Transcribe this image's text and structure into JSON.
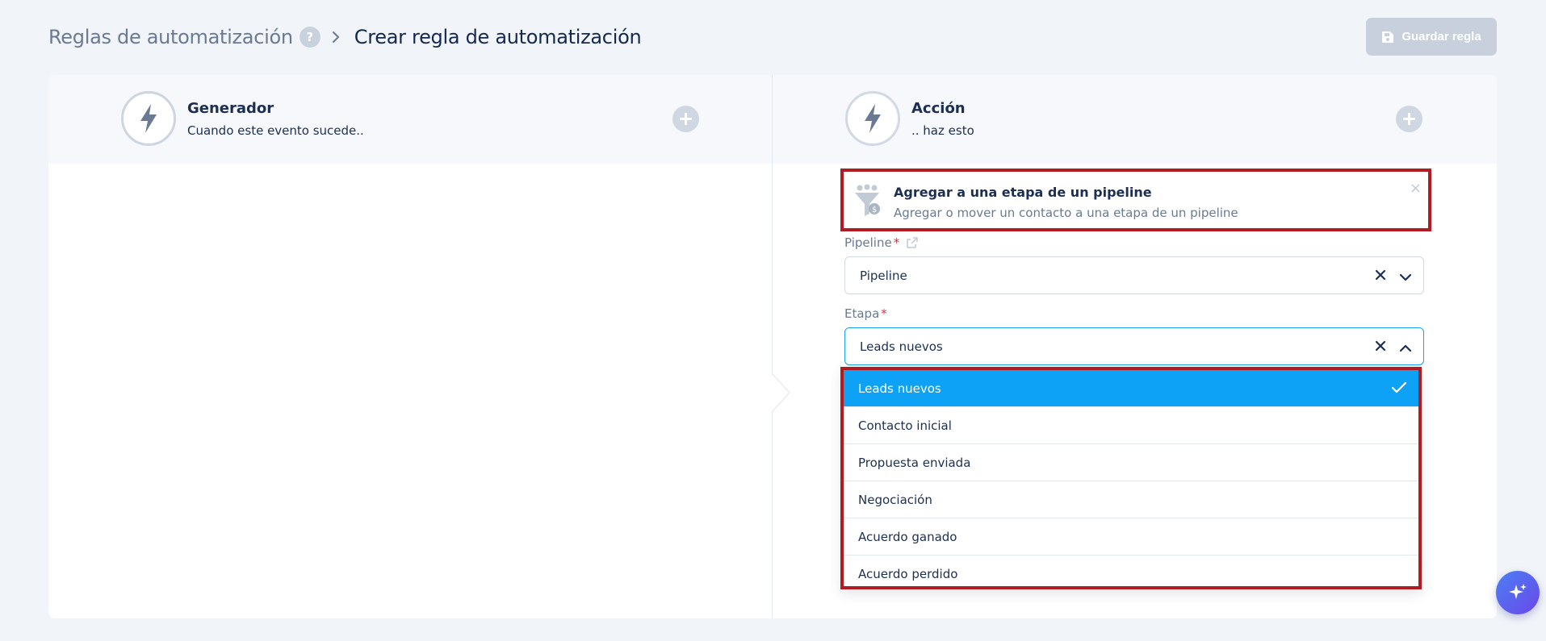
{
  "breadcrumb": {
    "root": "Reglas de automatización",
    "help": "?",
    "current": "Crear regla de automatización"
  },
  "toolbar": {
    "save_label": "Guardar regla"
  },
  "trigger_panel": {
    "title": "Generador",
    "subtitle": "Cuando este evento sucede.."
  },
  "action_panel": {
    "title": "Acción",
    "subtitle": ".. haz esto"
  },
  "action_card": {
    "title": "Agregar a una etapa de un pipeline",
    "description": "Agregar o mover un contacto a una etapa de un pipeline",
    "close": "×"
  },
  "pipeline_field": {
    "label": "Pipeline",
    "required": "*",
    "value": "Pipeline"
  },
  "stage_field": {
    "label": "Etapa",
    "required": "*",
    "value": "Leads nuevos"
  },
  "stage_options": [
    {
      "label": "Leads nuevos",
      "selected": true
    },
    {
      "label": "Contacto inicial",
      "selected": false
    },
    {
      "label": "Propuesta enviada",
      "selected": false
    },
    {
      "label": "Negociación",
      "selected": false
    },
    {
      "label": "Acuerdo ganado",
      "selected": false
    },
    {
      "label": "Acuerdo perdido",
      "selected": false
    }
  ],
  "colors": {
    "accent": "#0ea2f7",
    "highlight_border": "#b01c22",
    "required": "#e0303e",
    "background": "#f1f4f9"
  },
  "icons": {
    "help": "help-icon",
    "breadcrumb_separator": "chevron-right-icon",
    "save": "floppy-disk-icon",
    "trigger": "lightning-bolt-icon",
    "action": "lightning-refresh-icon",
    "add": "plus-icon",
    "action_card": "funnel-people-icon",
    "external": "external-link-icon",
    "clear": "x-icon",
    "expand": "chevron-down-icon",
    "collapse": "chevron-up-icon",
    "check": "check-icon",
    "assistant": "sparkles-icon"
  }
}
